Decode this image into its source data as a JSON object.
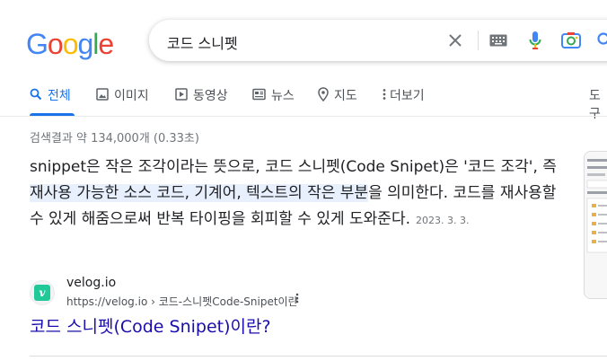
{
  "logo": {
    "letters": [
      "G",
      "o",
      "o",
      "g",
      "l",
      "e"
    ],
    "colors": [
      "#4285f4",
      "#ea4335",
      "#fbbc05",
      "#4285f4",
      "#34a853",
      "#ea4335"
    ]
  },
  "search": {
    "query": "코드 스니펫"
  },
  "tabs": [
    {
      "label": "전체",
      "icon": "search-icon",
      "active": true
    },
    {
      "label": "이미지",
      "icon": "image-icon"
    },
    {
      "label": "동영상",
      "icon": "video-icon"
    },
    {
      "label": "뉴스",
      "icon": "news-icon"
    },
    {
      "label": "지도",
      "icon": "map-pin-icon"
    },
    {
      "label": "더보기",
      "icon": "more-vert-icon"
    }
  ],
  "tools_label": "도구",
  "stats": "검색결과 약 134,000개 (0.33초)",
  "snippet": {
    "part1": "snippet은 작은 조각이라는 뜻으로, 코드 스니펫(Code Snipet)은 '코드 조각', 즉 ",
    "highlight": "재사용 가능한 소스 코드, 기계어, 텍스트의 작은 부분",
    "part2": "을 의미한다. 코드를 재사용할 수 있게 해줌으로써 반복 타이핑을 회피할 수 있게 도와준다.",
    "date": "2023. 3. 3."
  },
  "result": {
    "site_name": "velog.io",
    "url": "https://velog.io › 코드-스니펫Code-Snipet이란",
    "title": "코드 스니펫(Code Snipet)이란?",
    "favicon_letter": "v"
  },
  "colors": {
    "accent": "#1a73e8",
    "link": "#1a0dab",
    "highlight": "#e8f0fe"
  }
}
